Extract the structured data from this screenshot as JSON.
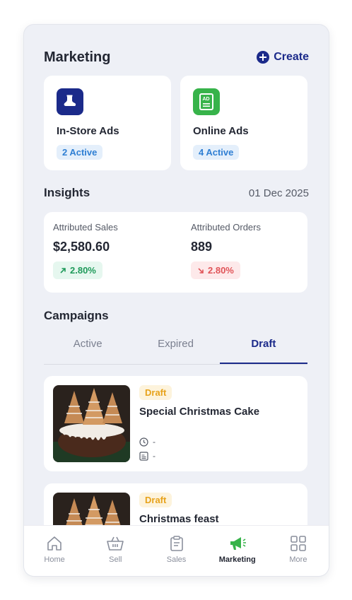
{
  "header": {
    "title": "Marketing",
    "create_label": "Create"
  },
  "ads": [
    {
      "name": "In-Store Ads",
      "status": "2 Active",
      "icon": "boot-icon",
      "color": "#1b2a8a"
    },
    {
      "name": "Online Ads",
      "status": "4 Active",
      "icon": "ad-icon",
      "color": "#37b34a"
    }
  ],
  "insights": {
    "title": "Insights",
    "date": "01 Dec 2025",
    "metrics": [
      {
        "label": "Attributed Sales",
        "value": "$2,580.60",
        "delta": "2.80%",
        "direction": "up"
      },
      {
        "label": "Attributed Orders",
        "value": "889",
        "delta": "2.80%",
        "direction": "down"
      }
    ]
  },
  "campaigns": {
    "title": "Campaigns",
    "tabs": [
      "Active",
      "Expired",
      "Draft"
    ],
    "selected_tab": "Draft",
    "items": [
      {
        "status": "Draft",
        "name": "Special Christmas Cake",
        "schedule": "-",
        "target": "-"
      },
      {
        "status": "Draft",
        "name": "Christmas feast"
      }
    ]
  },
  "nav": {
    "items": [
      {
        "label": "Home",
        "icon": "home-icon"
      },
      {
        "label": "Sell",
        "icon": "basket-icon"
      },
      {
        "label": "Sales",
        "icon": "clipboard-icon"
      },
      {
        "label": "Marketing",
        "icon": "megaphone-icon"
      },
      {
        "label": "More",
        "icon": "grid-icon"
      }
    ],
    "selected": "Marketing"
  },
  "colors": {
    "brand": "#1b2a8a",
    "success": "#1f9a5a",
    "danger": "#e05458",
    "draft": "#e7a21b",
    "accent_green": "#37b34a"
  }
}
